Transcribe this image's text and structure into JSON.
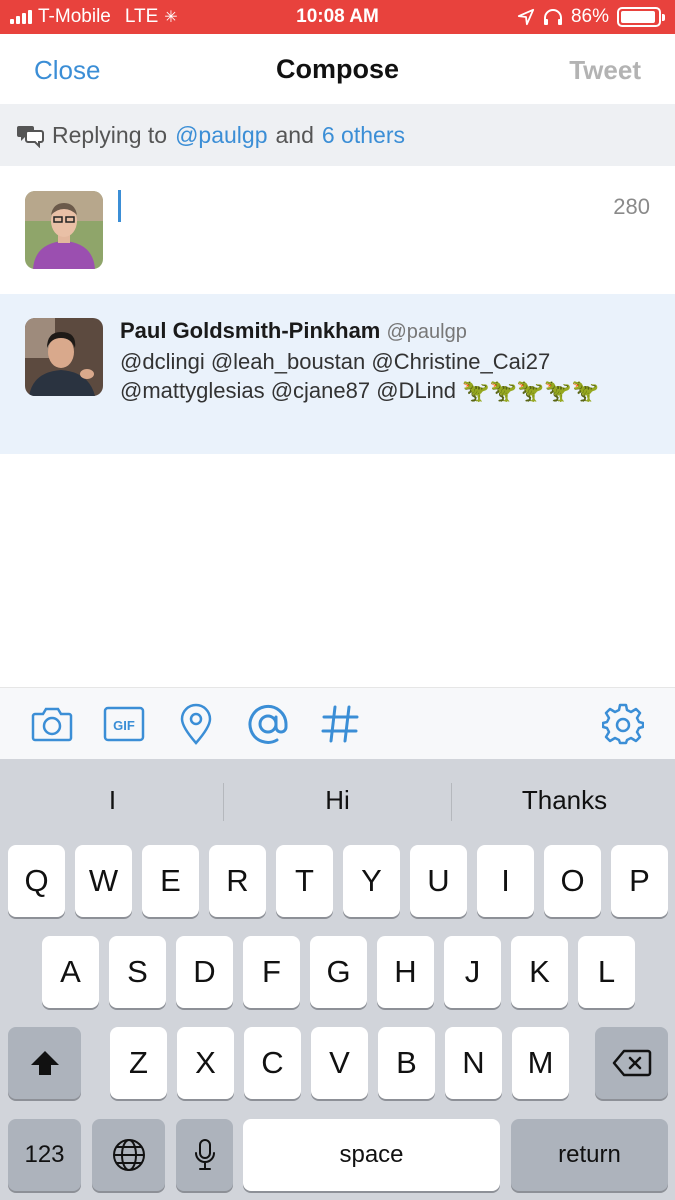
{
  "status_bar": {
    "carrier": "T-Mobile",
    "network": "LTE",
    "time": "10:08 AM",
    "battery": "86%",
    "battery_level": 0.86
  },
  "nav": {
    "close_label": "Close",
    "title": "Compose",
    "tweet_label": "Tweet"
  },
  "reply_banner": {
    "prefix": "Replying to",
    "handle": "@paulgp",
    "and": "and",
    "others": "6 others"
  },
  "composer": {
    "char_count": "280"
  },
  "quoted_tweet": {
    "name": "Paul Goldsmith-Pinkham",
    "handle": "@paulgp",
    "body": "@dclingi @leah_boustan @Christine_Cai27 @mattyglesias @cjane87 @DLind 🦖🦖🦖🦖🦖"
  },
  "toolbar": {
    "icons": [
      "camera-icon",
      "gif-icon",
      "location-pin-icon",
      "at-sign-icon",
      "hashtag-icon",
      "gear-icon"
    ],
    "gif_label": "GIF",
    "accent": "#3b8ed6"
  },
  "keyboard": {
    "suggestions": [
      "I",
      "Hi",
      "Thanks"
    ],
    "row1": [
      "Q",
      "W",
      "E",
      "R",
      "T",
      "Y",
      "U",
      "I",
      "O",
      "P"
    ],
    "row2": [
      "A",
      "S",
      "D",
      "F",
      "G",
      "H",
      "J",
      "K",
      "L"
    ],
    "row3": [
      "Z",
      "X",
      "C",
      "V",
      "B",
      "N",
      "M"
    ],
    "numbers_label": "123",
    "space_label": "space",
    "return_label": "return"
  }
}
